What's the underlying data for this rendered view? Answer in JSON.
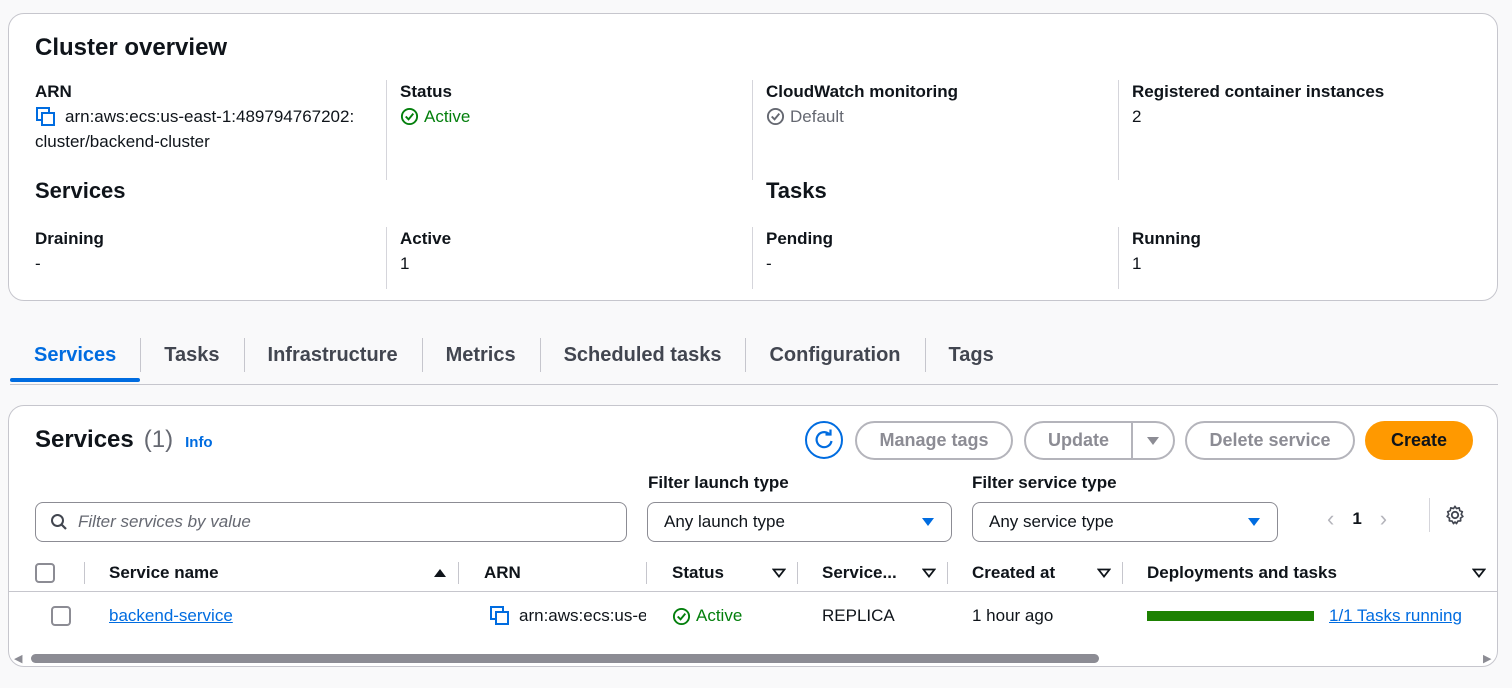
{
  "overview": {
    "title": "Cluster overview",
    "arn_label": "ARN",
    "arn_value_line1": "arn:aws:ecs:us-east-1:489794767202:",
    "arn_value_line2": "cluster/backend-cluster",
    "status_label": "Status",
    "status_value": "Active",
    "cloudwatch_label": "CloudWatch monitoring",
    "cloudwatch_value": "Default",
    "instances_label": "Registered container instances",
    "instances_value": "2",
    "services_title": "Services",
    "draining_label": "Draining",
    "draining_value": "-",
    "active_label": "Active",
    "active_value": "1",
    "tasks_title": "Tasks",
    "pending_label": "Pending",
    "pending_value": "-",
    "running_label": "Running",
    "running_value": "1"
  },
  "tabs": [
    {
      "label": "Services",
      "active": true
    },
    {
      "label": "Tasks"
    },
    {
      "label": "Infrastructure"
    },
    {
      "label": "Metrics"
    },
    {
      "label": "Scheduled tasks"
    },
    {
      "label": "Configuration"
    },
    {
      "label": "Tags"
    }
  ],
  "services_panel": {
    "title": "Services",
    "count": "(1)",
    "info": "Info",
    "buttons": {
      "manage_tags": "Manage tags",
      "update": "Update",
      "delete": "Delete service",
      "create": "Create"
    },
    "search_placeholder": "Filter services by value",
    "filter_launch_label": "Filter launch type",
    "filter_launch_value": "Any launch type",
    "filter_service_label": "Filter service type",
    "filter_service_value": "Any service type",
    "page": "1",
    "columns": [
      "Service name",
      "ARN",
      "Status",
      "Service...",
      "Created at",
      "Deployments and tasks"
    ],
    "rows": [
      {
        "service_name": "backend-service",
        "arn": "arn:aws:ecs:us-e",
        "status": "Active",
        "service_type": "REPLICA",
        "created_at": "1 hour ago",
        "deployments": "1/1 Tasks running",
        "progress": 1.0
      }
    ]
  },
  "colors": {
    "accent": "#006ce0",
    "success": "#037f0c",
    "primary_button": "#ff9900",
    "progress": "#1d8102"
  }
}
